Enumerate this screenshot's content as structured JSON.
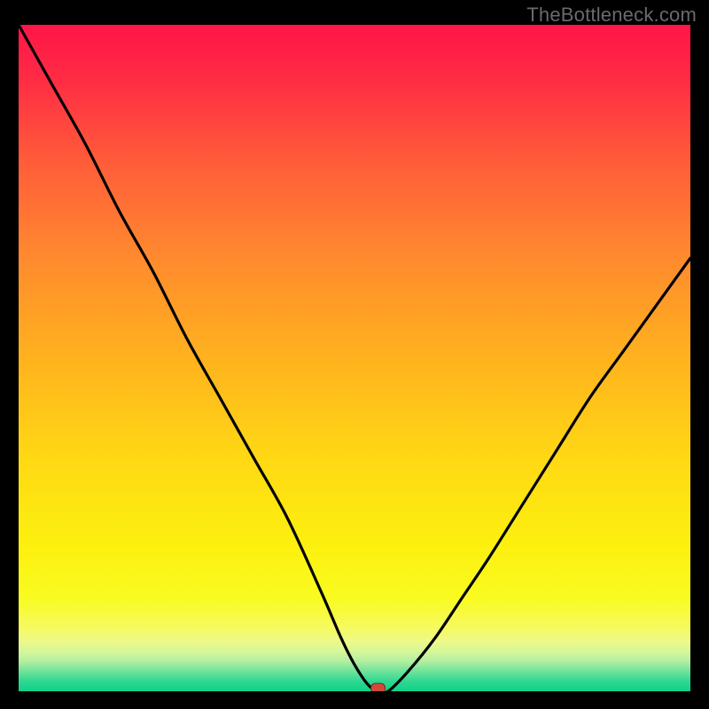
{
  "watermark": "TheBottleneck.com",
  "chart_data": {
    "type": "line",
    "title": "",
    "xlabel": "",
    "ylabel": "",
    "xlim": [
      0,
      100
    ],
    "ylim": [
      0,
      100
    ],
    "x": [
      0,
      5,
      10,
      15,
      20,
      25,
      30,
      35,
      40,
      45,
      48,
      50,
      52,
      53.5,
      55,
      58,
      62,
      66,
      70,
      75,
      80,
      85,
      90,
      95,
      100
    ],
    "values": [
      100,
      91,
      82,
      72,
      63,
      53,
      44,
      35,
      26,
      15,
      8,
      4,
      1,
      0,
      0,
      3,
      8,
      14,
      20,
      28,
      36,
      44,
      51,
      58,
      65
    ],
    "background": "red-yellow-green vertical gradient with green band at bottom",
    "marker": {
      "x": 53.5,
      "y": 0,
      "color": "#cf4a3b"
    },
    "series": [
      {
        "name": "bottleneck-curve",
        "color": "#000000"
      }
    ]
  }
}
